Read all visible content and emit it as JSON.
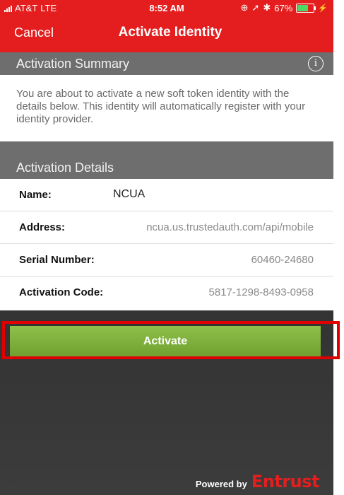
{
  "status_bar": {
    "carrier": "AT&T",
    "network": "LTE",
    "time": "8:52 AM",
    "battery": "67%",
    "battery_level": 0.67
  },
  "nav": {
    "cancel_label": "Cancel",
    "title": "Activate Identity"
  },
  "summary": {
    "header": "Activation Summary",
    "text": "You are about to activate a new soft token identity with the details below. This identity will automatically register with your identity provider."
  },
  "details": {
    "header": "Activation Details",
    "rows": [
      {
        "label": "Name:",
        "value": "NCUA"
      },
      {
        "label": "Address:",
        "value": "ncua.us.trustedauth.com/api/mobile"
      },
      {
        "label": "Serial Number:",
        "value": "60460-24680"
      },
      {
        "label": "Activation Code:",
        "value": "5817-1298-8493-0958"
      }
    ]
  },
  "activate_label": "Activate",
  "footer": {
    "powered_by": "Powered by",
    "brand": "Entrust"
  },
  "colors": {
    "brand_red": "#e41e1e",
    "button_green": "#7bac38",
    "header_gray": "#6e6e6e",
    "highlight": "#e00000"
  },
  "icons": [
    "signal-icon",
    "location-icon",
    "arrow-icon",
    "bluetooth-icon",
    "battery-icon",
    "info-icon"
  ]
}
